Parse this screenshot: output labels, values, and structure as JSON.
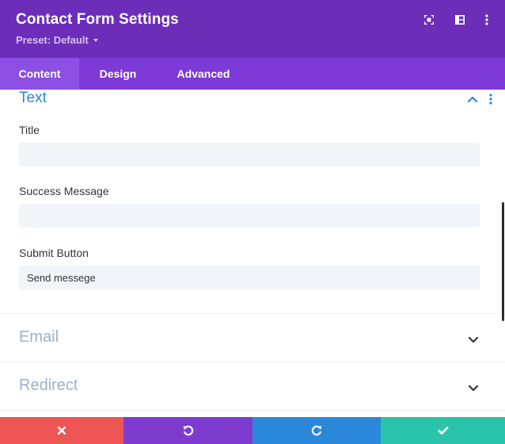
{
  "header": {
    "title": "Contact Form Settings",
    "preset_label": "Preset: Default",
    "icons": [
      "fullscreen-icon",
      "split-view-icon",
      "more-options-icon"
    ]
  },
  "tabs": [
    {
      "label": "Content",
      "active": true
    },
    {
      "label": "Design",
      "active": false
    },
    {
      "label": "Advanced",
      "active": false
    }
  ],
  "sections": {
    "text": {
      "title": "Text",
      "expanded": true,
      "fields": {
        "title": {
          "label": "Title",
          "value": ""
        },
        "success_message": {
          "label": "Success Message",
          "value": ""
        },
        "submit_button": {
          "label": "Submit Button",
          "value": "Send messege"
        }
      }
    },
    "email": {
      "title": "Email",
      "expanded": false
    },
    "redirect": {
      "title": "Redirect",
      "expanded": false
    }
  },
  "footer": {
    "buttons": [
      {
        "name": "cancel",
        "icon": "close-icon",
        "color": "#ef5555"
      },
      {
        "name": "undo",
        "icon": "undo-icon",
        "color": "#7e3bd0"
      },
      {
        "name": "redo",
        "icon": "redo-icon",
        "color": "#2b87da"
      },
      {
        "name": "save",
        "icon": "check-icon",
        "color": "#29c4a9"
      }
    ]
  },
  "colors": {
    "header_bg": "#6c2eb9",
    "tabs_bg": "#7d3ad6",
    "active_tab_bg": "#8d4fe3",
    "accent_blue": "#2b87da",
    "input_bg": "#f1f4f8",
    "collapsed_heading": "#a2b0c1"
  }
}
